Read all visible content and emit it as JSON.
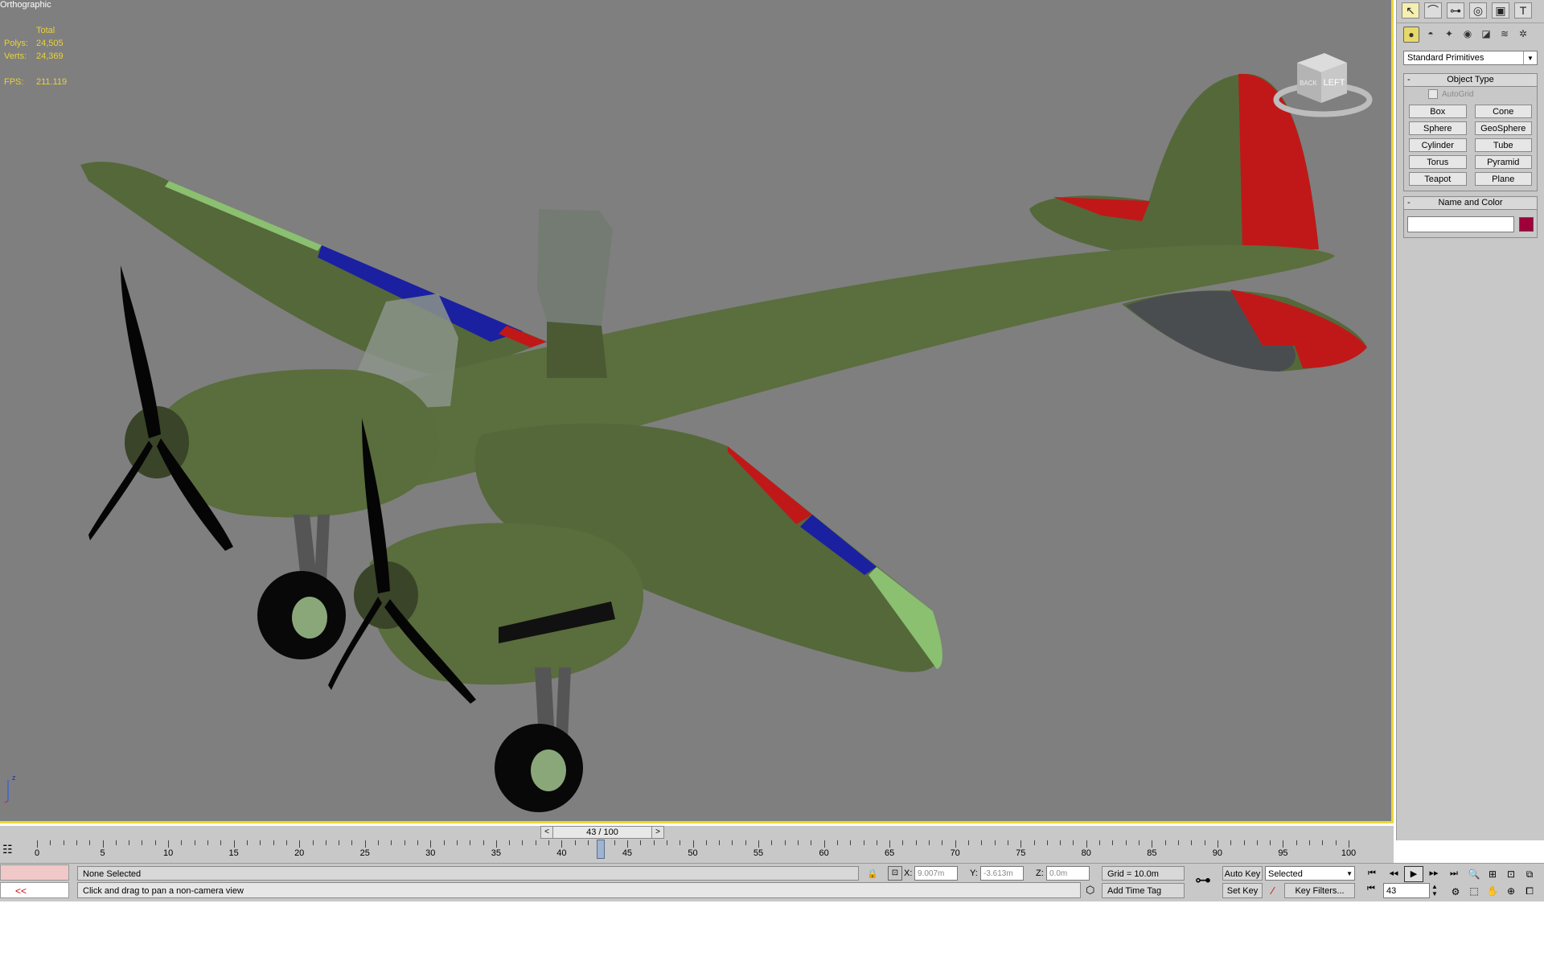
{
  "viewport": {
    "label": "Orthographic",
    "stats": {
      "header": "Total",
      "polys_label": "Polys:",
      "polys": "24,505",
      "verts_label": "Verts:",
      "verts": "24,369",
      "fps_label": "FPS:",
      "fps": "211.119"
    },
    "viewcube_face": "LEFT",
    "viewcube_side": "BACK",
    "axis_label": "z",
    "model_colors": {
      "body": "#55683a",
      "red": "#c01818",
      "blue": "#1a20a0",
      "light_green": "#8ac070"
    }
  },
  "command_panel": {
    "tabs": [
      "create-icon",
      "modify-icon",
      "hierarchy-icon",
      "motion-icon",
      "display-icon",
      "utilities-icon"
    ],
    "tab_glyphs": [
      "↖",
      "⌒",
      "⊶",
      "◎",
      "▣",
      "T"
    ],
    "subtabs": [
      "●",
      "◓",
      "✦",
      "◉",
      "◪",
      "≋",
      "✲"
    ],
    "category": "Standard Primitives",
    "object_type": {
      "title": "Object Type",
      "autogrid": "AutoGrid",
      "buttons": [
        "Box",
        "Cone",
        "Sphere",
        "GeoSphere",
        "Cylinder",
        "Tube",
        "Torus",
        "Pyramid",
        "Teapot",
        "Plane"
      ]
    },
    "name_and_color": {
      "title": "Name and Color",
      "name": "",
      "color": "#a0003a"
    },
    "collapse_symbol": "-"
  },
  "time_slider": {
    "label": "43 / 100",
    "prev": "<",
    "next": ">"
  },
  "track_bar": {
    "labels": [
      "0",
      "5",
      "10",
      "15",
      "20",
      "25",
      "30",
      "35",
      "40",
      "45",
      "50",
      "55",
      "60",
      "65",
      "70",
      "75",
      "80",
      "85",
      "90",
      "95",
      "100"
    ],
    "current_frame": 43
  },
  "status": {
    "maxscript_button": "<<",
    "selection": "None Selected",
    "prompt": "Click and drag to pan a non-camera view",
    "x_label": "X:",
    "x": "9.007m",
    "y_label": "Y:",
    "y": "-3.613m",
    "z_label": "Z:",
    "z": "0.0m",
    "grid": "Grid = 10.0m",
    "add_time_tag": "Add Time Tag",
    "auto_key": "Auto Key",
    "set_key": "Set Key",
    "key_mode": "Selected",
    "key_filters": "Key Filters...",
    "frame": "43"
  }
}
